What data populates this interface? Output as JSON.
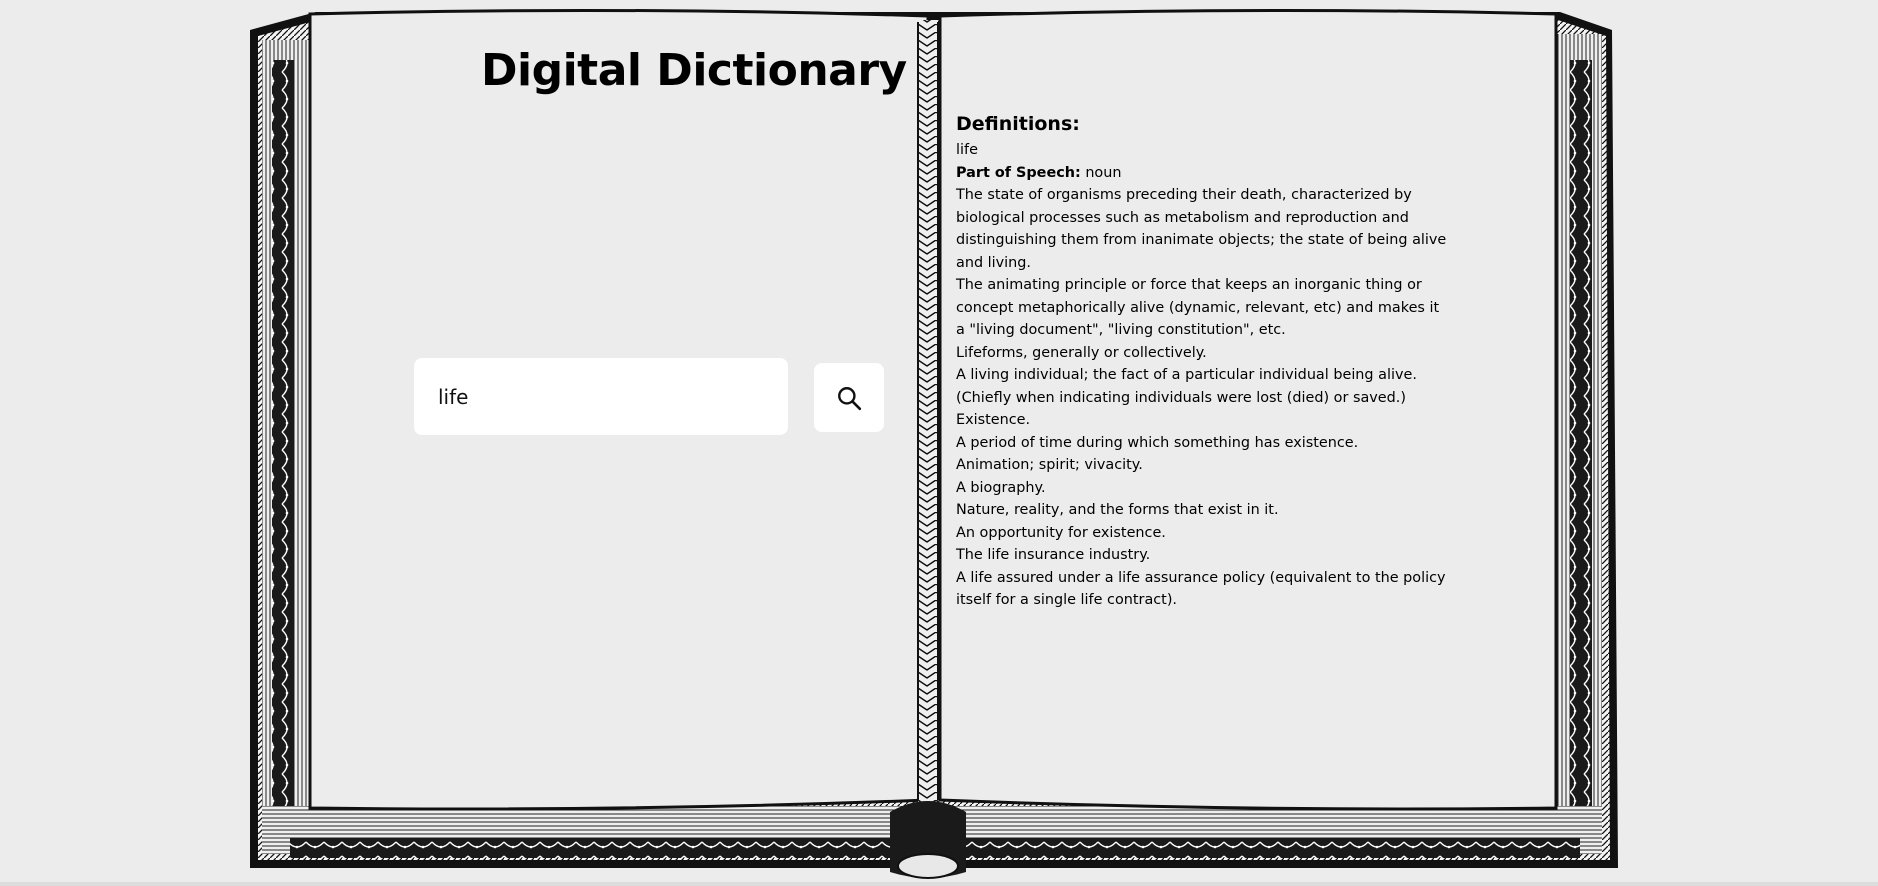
{
  "header": {
    "title": "Digital Dictionary"
  },
  "search": {
    "value": "life",
    "button_icon": "search-icon"
  },
  "results": {
    "heading": "Definitions:",
    "word": "life",
    "part_of_speech_label": "Part of Speech:",
    "part_of_speech": "noun",
    "definitions": [
      "The state of organisms preceding their death, characterized by biological processes such as metabolism and reproduction and distinguishing them from inanimate objects; the state of being alive and living.",
      "The animating principle or force that keeps an inorganic thing or concept metaphorically alive (dynamic, relevant, etc) and makes it a \"living document\", \"living constitution\", etc.",
      "Lifeforms, generally or collectively.",
      "A living individual; the fact of a particular individual being alive. (Chiefly when indicating individuals were lost (died) or saved.)",
      "Existence.",
      "A period of time during which something has existence.",
      "Animation; spirit; vivacity.",
      "A biography.",
      "Nature, reality, and the forms that exist in it.",
      "An opportunity for existence.",
      "The life insurance industry.",
      "A life assured under a life assurance policy (equivalent to the policy itself for a single life contract)."
    ]
  },
  "colors": {
    "background": "#ececec",
    "page": "#ececec",
    "ink": "#000000",
    "input_bg": "#ffffff"
  }
}
